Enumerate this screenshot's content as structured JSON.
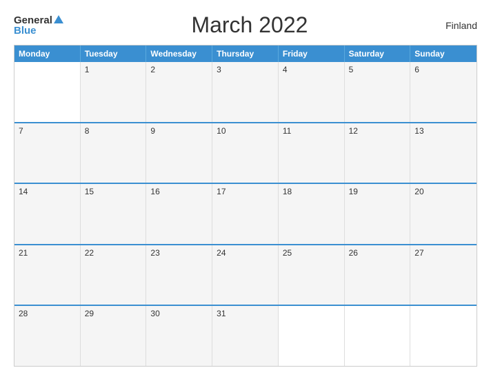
{
  "header": {
    "logo_general": "General",
    "logo_blue": "Blue",
    "title": "March 2022",
    "country": "Finland"
  },
  "calendar": {
    "days": [
      "Monday",
      "Tuesday",
      "Wednesday",
      "Thursday",
      "Friday",
      "Saturday",
      "Sunday"
    ],
    "weeks": [
      [
        {
          "day": "",
          "empty": true
        },
        {
          "day": "1",
          "empty": false
        },
        {
          "day": "2",
          "empty": false
        },
        {
          "day": "3",
          "empty": false
        },
        {
          "day": "4",
          "empty": false
        },
        {
          "day": "5",
          "empty": false
        },
        {
          "day": "6",
          "empty": false
        }
      ],
      [
        {
          "day": "7",
          "empty": false
        },
        {
          "day": "8",
          "empty": false
        },
        {
          "day": "9",
          "empty": false
        },
        {
          "day": "10",
          "empty": false
        },
        {
          "day": "11",
          "empty": false
        },
        {
          "day": "12",
          "empty": false
        },
        {
          "day": "13",
          "empty": false
        }
      ],
      [
        {
          "day": "14",
          "empty": false
        },
        {
          "day": "15",
          "empty": false
        },
        {
          "day": "16",
          "empty": false
        },
        {
          "day": "17",
          "empty": false
        },
        {
          "day": "18",
          "empty": false
        },
        {
          "day": "19",
          "empty": false
        },
        {
          "day": "20",
          "empty": false
        }
      ],
      [
        {
          "day": "21",
          "empty": false
        },
        {
          "day": "22",
          "empty": false
        },
        {
          "day": "23",
          "empty": false
        },
        {
          "day": "24",
          "empty": false
        },
        {
          "day": "25",
          "empty": false
        },
        {
          "day": "26",
          "empty": false
        },
        {
          "day": "27",
          "empty": false
        }
      ],
      [
        {
          "day": "28",
          "empty": false
        },
        {
          "day": "29",
          "empty": false
        },
        {
          "day": "30",
          "empty": false
        },
        {
          "day": "31",
          "empty": false
        },
        {
          "day": "",
          "empty": true
        },
        {
          "day": "",
          "empty": true
        },
        {
          "day": "",
          "empty": true
        }
      ]
    ]
  }
}
